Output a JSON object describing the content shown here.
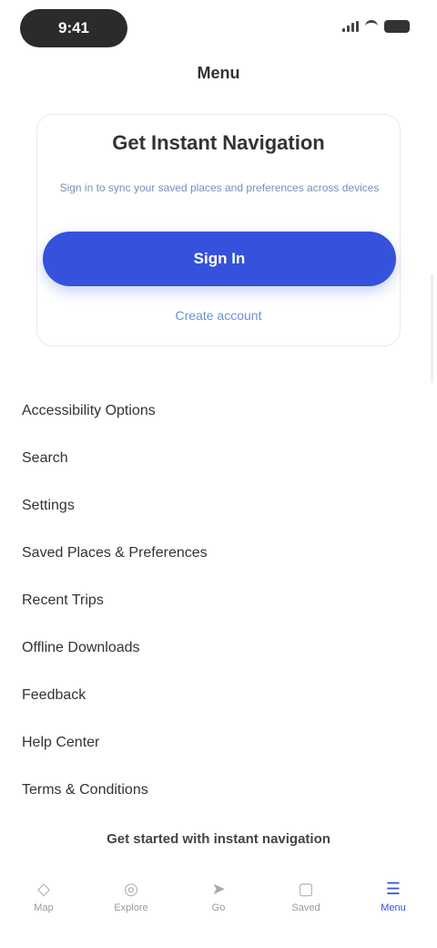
{
  "status_bar": {
    "time": "9:41"
  },
  "menu": {
    "title": "Menu"
  },
  "signin_card": {
    "heading": "Get Instant Navigation",
    "subtitle": "Sign in to sync your saved places and preferences across devices",
    "primary_button": "Sign In",
    "secondary_link": "Create account"
  },
  "menu_items": [
    "Accessibility Options",
    "Search",
    "Settings",
    "Saved Places & Preferences",
    "Recent Trips",
    "Offline Downloads",
    "Feedback",
    "Help Center",
    "Terms & Conditions"
  ],
  "footer": {
    "caption": "Get started with instant navigation"
  },
  "tabs": [
    {
      "label": "Map",
      "icon": "map-icon"
    },
    {
      "label": "Explore",
      "icon": "explore-icon"
    },
    {
      "label": "Go",
      "icon": "navigate-icon"
    },
    {
      "label": "Saved",
      "icon": "bookmark-icon"
    },
    {
      "label": "Menu",
      "icon": "menu-icon"
    }
  ],
  "colors": {
    "accent": "#3552dd",
    "link": "#6e8fd6"
  }
}
